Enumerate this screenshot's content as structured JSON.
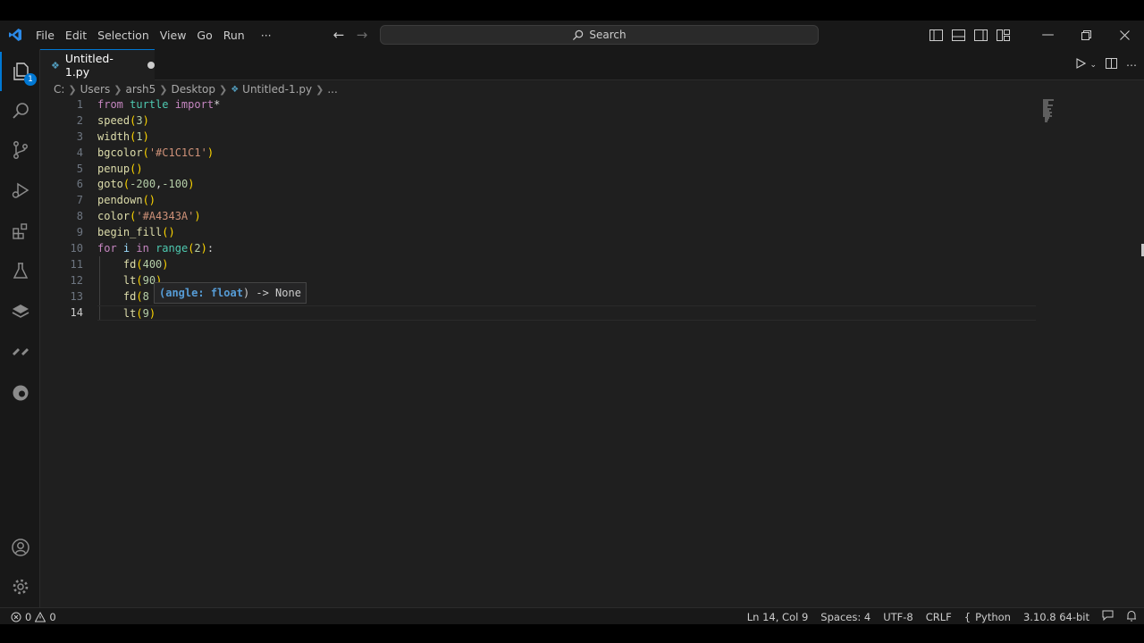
{
  "menu": [
    "File",
    "Edit",
    "Selection",
    "View",
    "Go",
    "Run",
    "···"
  ],
  "search": {
    "label": "Search"
  },
  "tab": {
    "filename": "Untitled-1.py"
  },
  "breadcrumb": [
    "C:",
    "Users",
    "arsh5",
    "Desktop",
    "Untitled-1.py",
    "..."
  ],
  "activity_badge": "1",
  "line_numbers": [
    "1",
    "2",
    "3",
    "4",
    "5",
    "6",
    "7",
    "8",
    "9",
    "10",
    "11",
    "12",
    "13",
    "14"
  ],
  "code_lines": [
    [
      {
        "t": "from",
        "c": "kw"
      },
      {
        "t": " turtle ",
        "c": "mod"
      },
      {
        "t": "import",
        "c": "kw"
      },
      {
        "t": "*",
        "c": "pun"
      }
    ],
    [
      {
        "t": "speed",
        "c": "fn"
      },
      {
        "t": "(",
        "c": "par"
      },
      {
        "t": "3",
        "c": "num"
      },
      {
        "t": ")",
        "c": "par"
      }
    ],
    [
      {
        "t": "width",
        "c": "fn"
      },
      {
        "t": "(",
        "c": "par"
      },
      {
        "t": "1",
        "c": "num"
      },
      {
        "t": ")",
        "c": "par"
      }
    ],
    [
      {
        "t": "bgcolor",
        "c": "fn"
      },
      {
        "t": "(",
        "c": "par"
      },
      {
        "t": "'#C1C1C1'",
        "c": "str"
      },
      {
        "t": ")",
        "c": "par"
      }
    ],
    [
      {
        "t": "penup",
        "c": "fn"
      },
      {
        "t": "()",
        "c": "par"
      }
    ],
    [
      {
        "t": "goto",
        "c": "fn"
      },
      {
        "t": "(",
        "c": "par"
      },
      {
        "t": "-200",
        "c": "num"
      },
      {
        "t": ",",
        "c": "pun"
      },
      {
        "t": "-100",
        "c": "num"
      },
      {
        "t": ")",
        "c": "par"
      }
    ],
    [
      {
        "t": "pendown",
        "c": "fn"
      },
      {
        "t": "()",
        "c": "par"
      }
    ],
    [
      {
        "t": "color",
        "c": "fn"
      },
      {
        "t": "(",
        "c": "par"
      },
      {
        "t": "'#A4343A'",
        "c": "str"
      },
      {
        "t": ")",
        "c": "par"
      }
    ],
    [
      {
        "t": "begin_fill",
        "c": "fn"
      },
      {
        "t": "()",
        "c": "par"
      }
    ],
    [
      {
        "t": "for",
        "c": "kw"
      },
      {
        "t": " i ",
        "c": "var"
      },
      {
        "t": "in",
        "c": "kw"
      },
      {
        "t": " ",
        "c": "pun"
      },
      {
        "t": "range",
        "c": "mod"
      },
      {
        "t": "(",
        "c": "par"
      },
      {
        "t": "2",
        "c": "num"
      },
      {
        "t": ")",
        "c": "par"
      },
      {
        "t": ":",
        "c": "pun"
      }
    ],
    [
      {
        "t": "    fd",
        "c": "fn"
      },
      {
        "t": "(",
        "c": "par"
      },
      {
        "t": "400",
        "c": "num"
      },
      {
        "t": ")",
        "c": "par"
      }
    ],
    [
      {
        "t": "    lt",
        "c": "fn"
      },
      {
        "t": "(",
        "c": "par"
      },
      {
        "t": "90",
        "c": "num"
      },
      {
        "t": ")",
        "c": "par"
      }
    ],
    [
      {
        "t": "    fd",
        "c": "fn"
      },
      {
        "t": "(",
        "c": "par"
      },
      {
        "t": "8",
        "c": "num"
      }
    ],
    [
      {
        "t": "    lt",
        "c": "fn"
      },
      {
        "t": "(",
        "c": "par"
      },
      {
        "t": "9",
        "c": "num"
      },
      {
        "t": ")",
        "c": "par"
      }
    ]
  ],
  "hint": {
    "open": "(",
    "param": "angle",
    "sep": ": ",
    "type": "float",
    "rest": ") -> None"
  },
  "status": {
    "errors": "0",
    "warnings": "0",
    "position": "Ln 14, Col 9",
    "spaces": "Spaces: 4",
    "encoding": "UTF-8",
    "eol": "CRLF",
    "language": "Python",
    "interpreter": "3.10.8 64-bit"
  },
  "colors": {
    "accent": "#0078d4",
    "editor_bg": "#1f1f1f",
    "chrome_bg": "#181818"
  }
}
